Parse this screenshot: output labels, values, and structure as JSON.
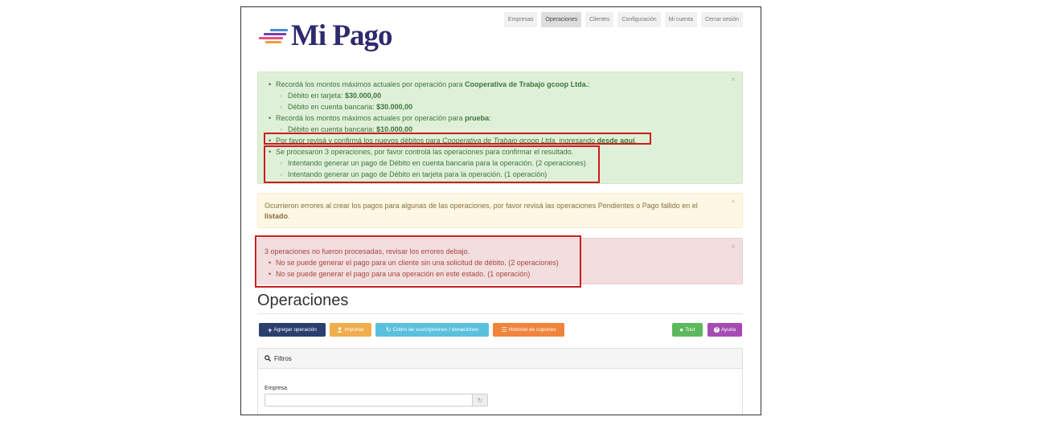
{
  "brand": {
    "name": "Mi Pago",
    "colors": [
      "#4a8ad4",
      "#7b3fa6",
      "#e94c8a",
      "#f0a030"
    ]
  },
  "nav": [
    "Empresas",
    "Operaciones",
    "Clientes",
    "Configuración",
    "Mi cuenta",
    "Cerrar sesión"
  ],
  "success": {
    "l1_a": "Recordá los montos máximos actuales por operación para ",
    "l1_b": "Cooperativa de Trabajo gcoop Ltda.",
    "l1_c": ":",
    "l2_a": "Débito en tarjeta: ",
    "l2_b": "$30.000,00",
    "l3_a": "Débito en cuenta bancaria: ",
    "l3_b": "$30.000,00",
    "l4_a": "Recordá los montos máximos actuales por operación para ",
    "l4_b": "prueba",
    "l4_c": ":",
    "l5_a": "Débito en cuenta bancaria: ",
    "l5_b": "$10.000,00",
    "l6_a": "Por favor revisá y confirmá los nuevos débitos para ",
    "l6_b": "Cooperativa de Trabajo gcoop Ltda.",
    "l6_c": " ingresando ",
    "l6_d": "desde aquí",
    "l6_e": ".",
    "l7": "Se procesaron 3 operaciones, por favor controlá las operaciones para confirmar el resultado.",
    "l8": "Intentando generar un pago de Débito en cuenta bancaria para la operación. (2 operaciones)",
    "l9": "Intentando generar un pago de Débito en tarjeta para la operación. (1 operación)"
  },
  "warning": {
    "text": "Ocurrieron errores al crear los pagos para algunas de las operaciones, por favor revisá las operaciones Pendientes o Pago fallido en el ",
    "link": "listado",
    "end": "."
  },
  "danger": {
    "title": "3 operaciones no fueron procesadas, revisar los errores debajo.",
    "items": [
      "No se puede generar el pago para un cliente sin una solicitud de débito. (2 operaciones)",
      "No se puede generar el pago para una operación en este estado. (1 operación)"
    ]
  },
  "close_glyph": "×",
  "page_title": "Operaciones",
  "buttons": {
    "add": "Agregar operación",
    "import": "Importar",
    "charge": "Cobro de suscripciones / donaciones",
    "history": "Historial de cupones",
    "tour": "Tour",
    "help": "Ayuda"
  },
  "button_colors": {
    "add": "#2a3f6e",
    "import": "#f0ad4e",
    "charge": "#5bc0de",
    "history": "#f0843c",
    "tour": "#5cb85c",
    "help": "#a54bb3"
  },
  "icons": {
    "add": "plus-icon",
    "import": "user-icon",
    "charge": "refresh-icon",
    "history": "list-icon",
    "tour": "globe-icon",
    "help": "question-icon",
    "filter": "search-icon",
    "field": "refresh-icon"
  },
  "filters": {
    "title": "Filtros",
    "company_label": "Empresa",
    "company_value": ""
  }
}
